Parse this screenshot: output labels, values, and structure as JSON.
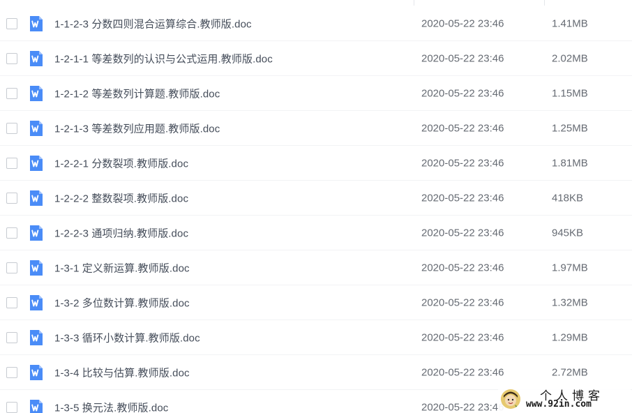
{
  "columns": {
    "name": "",
    "modified": "",
    "size": ""
  },
  "files": [
    {
      "name": "1-1-2-3 分数四则混合运算综合.教师版.doc",
      "modified": "2020-05-22 23:46",
      "size": "1.41MB",
      "icon": "word-doc-icon"
    },
    {
      "name": "1-2-1-1 等差数列的认识与公式运用.教师版.doc",
      "modified": "2020-05-22 23:46",
      "size": "2.02MB",
      "icon": "word-doc-icon"
    },
    {
      "name": "1-2-1-2 等差数列计算题.教师版.doc",
      "modified": "2020-05-22 23:46",
      "size": "1.15MB",
      "icon": "word-doc-icon"
    },
    {
      "name": "1-2-1-3 等差数列应用题.教师版.doc",
      "modified": "2020-05-22 23:46",
      "size": "1.25MB",
      "icon": "word-doc-icon"
    },
    {
      "name": "1-2-2-1 分数裂项.教师版.doc",
      "modified": "2020-05-22 23:46",
      "size": "1.81MB",
      "icon": "word-doc-icon"
    },
    {
      "name": "1-2-2-2 整数裂项.教师版.doc",
      "modified": "2020-05-22 23:46",
      "size": "418KB",
      "icon": "word-doc-icon"
    },
    {
      "name": "1-2-2-3 通项归纳.教师版.doc",
      "modified": "2020-05-22 23:46",
      "size": "945KB",
      "icon": "word-doc-icon"
    },
    {
      "name": "1-3-1 定义新运算.教师版.doc",
      "modified": "2020-05-22 23:46",
      "size": "1.97MB",
      "icon": "word-doc-icon"
    },
    {
      "name": "1-3-2 多位数计算.教师版.doc",
      "modified": "2020-05-22 23:46",
      "size": "1.32MB",
      "icon": "word-doc-icon"
    },
    {
      "name": "1-3-3 循环小数计算.教师版.doc",
      "modified": "2020-05-22 23:46",
      "size": "1.29MB",
      "icon": "word-doc-icon"
    },
    {
      "name": "1-3-4 比较与估算.教师版.doc",
      "modified": "2020-05-22 23:46",
      "size": "2.72MB",
      "icon": "word-doc-icon"
    },
    {
      "name": "1-3-5 换元法.教师版.doc",
      "modified": "2020-05-22 23:46",
      "size": "",
      "icon": "word-doc-icon"
    }
  ],
  "watermark": {
    "title": "个人博客",
    "url": "www.92in.com"
  },
  "colors": {
    "word_icon": "#4a8cf7",
    "text_primary": "#454d5a",
    "text_secondary": "#666b73",
    "checkbox_border": "#c7cbd1"
  }
}
